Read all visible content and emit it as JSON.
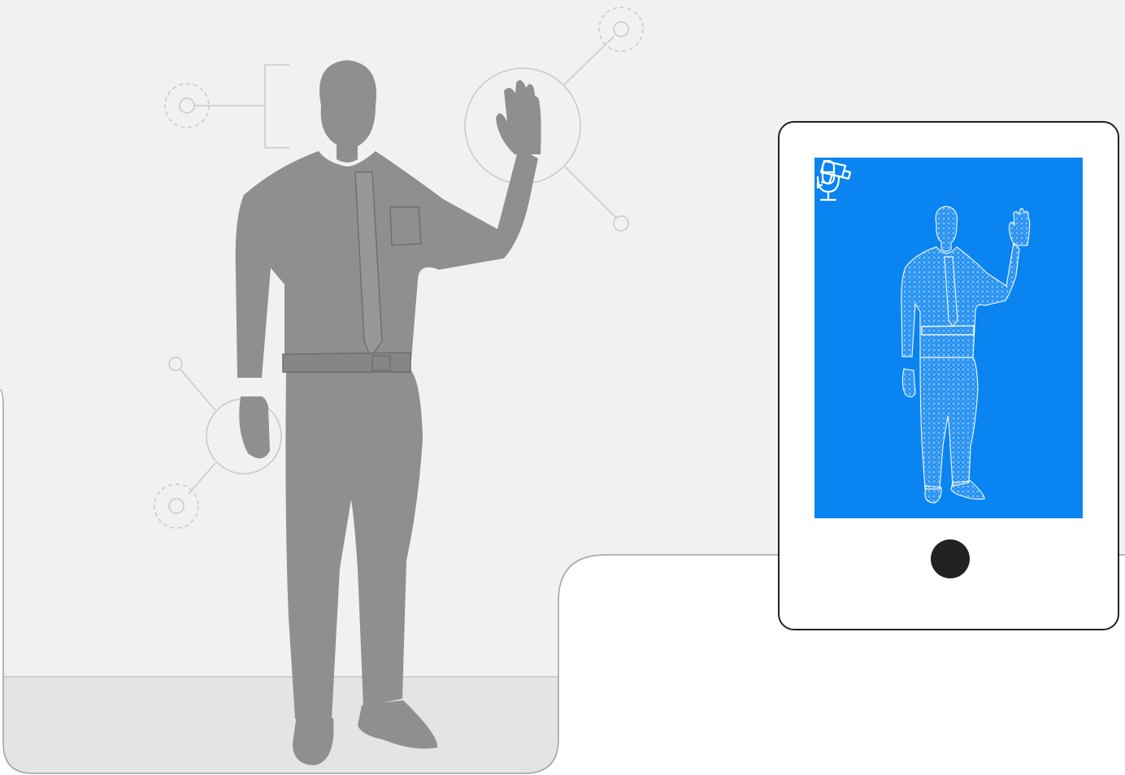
{
  "scene": {
    "subject": "person-waving",
    "colors": {
      "page": "#ffffff",
      "studio": "#f1f1f1",
      "floor": "#e4e4e4",
      "figure": "#8f8f8f",
      "outline": "#a0a0a0",
      "node_line": "#c8c8c8",
      "tablet_border": "#222222",
      "screen": "#0a84f0",
      "wireframe": "#e8f3ff"
    }
  },
  "tablet": {
    "icons": {
      "camera": "security-camera-icon",
      "microphone": "microphone-icon"
    },
    "button": "home-button"
  }
}
